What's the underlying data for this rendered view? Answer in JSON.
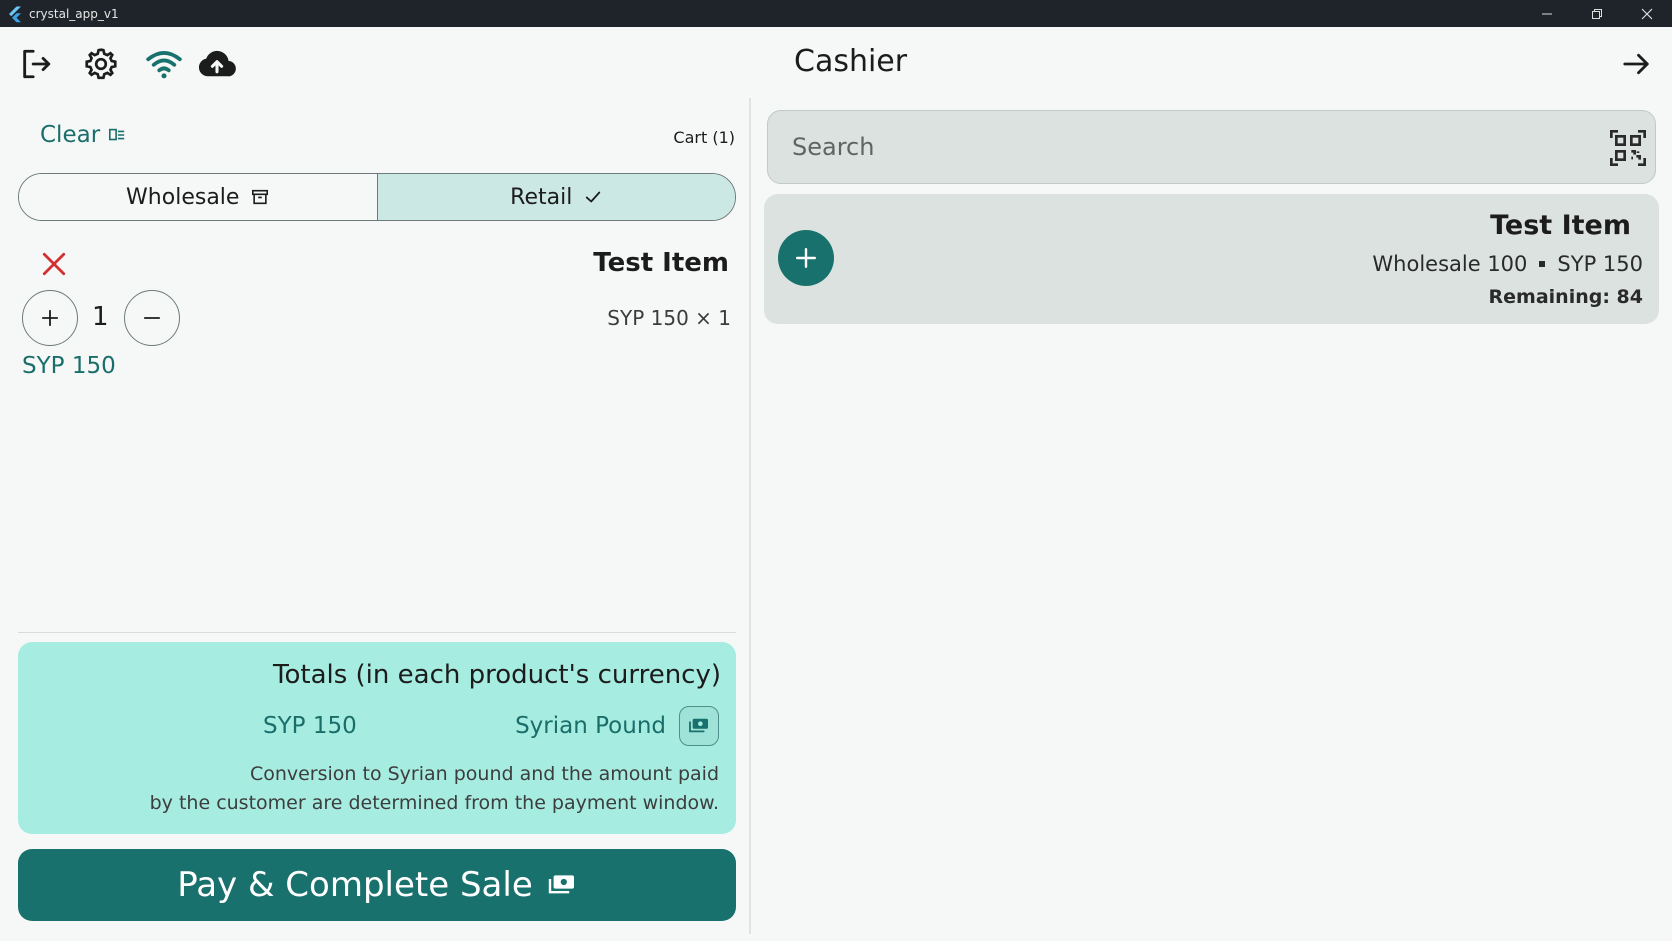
{
  "window": {
    "title": "crystal_app_v1"
  },
  "header": {
    "title": "Cashier",
    "icons": [
      "logout-icon",
      "gear-icon",
      "wifi-icon",
      "cloud-upload-icon",
      "arrow-right-icon"
    ]
  },
  "cart": {
    "clear_label": "Clear",
    "count_label": "Cart (1)",
    "mode_options": [
      {
        "label": "Wholesale",
        "selected": false
      },
      {
        "label": "Retail",
        "selected": true
      }
    ],
    "items": [
      {
        "name": "Test Item",
        "quantity": "1",
        "unit_line": "SYP 150 × 1",
        "line_total": "SYP 150"
      }
    ]
  },
  "totals": {
    "title": "Totals (in each product's currency)",
    "amount": "SYP 150",
    "currency": "Syrian Pound",
    "note_line1": "Conversion to Syrian pound and the amount paid",
    "note_line2": "by the customer are determined from the payment window."
  },
  "pay_button": {
    "label": "Pay & Complete Sale"
  },
  "search": {
    "placeholder": "Search",
    "value": ""
  },
  "products": [
    {
      "name": "Test Item",
      "wholesale": "Wholesale 100",
      "retail": "SYP 150",
      "remaining": "Remaining: 84"
    }
  ],
  "colors": {
    "accent": "#18716c",
    "accent_text": "#1a6e6a",
    "totals_bg": "#a6ece1",
    "selected_segment": "#cce8e5",
    "card_bg": "#dbe2e0",
    "remove": "#d32f2f",
    "titlebar": "#1f232a"
  }
}
